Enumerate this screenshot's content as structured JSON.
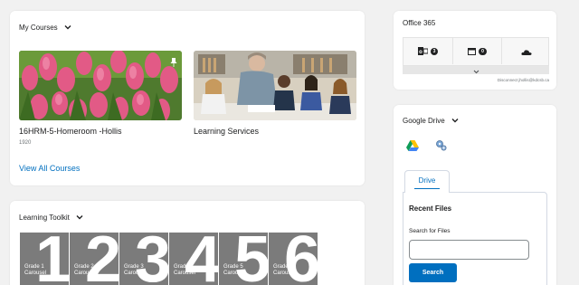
{
  "my_courses": {
    "title": "My Courses",
    "courses": [
      {
        "name": "16HRM-5-Homeroom -Hollis",
        "code": "1920",
        "image": "pink-tulips-photo",
        "pinned": true
      },
      {
        "name": "Learning Services",
        "code": "",
        "image": "classroom-teacher-students-photo",
        "pinned": false
      }
    ],
    "view_all": "View All Courses"
  },
  "learning_toolkit": {
    "title": "Learning Toolkit",
    "tiles": [
      {
        "label": "Grade 1 Carousel",
        "number": "1"
      },
      {
        "label": "Grade 2 Carousel",
        "number": "2"
      },
      {
        "label": "Grade 3 Carousel",
        "number": "3"
      },
      {
        "label": "Grade 4 Carousel",
        "number": "4"
      },
      {
        "label": "Grade 5 Carousel",
        "number": "5"
      },
      {
        "label": "Grade 6 Carousel",
        "number": "6"
      }
    ]
  },
  "office365": {
    "title": "Office 365",
    "mail_count": "3",
    "calendar_count": "0",
    "disconnect_text": "Disconnect jhollis@kdcsb.ca",
    "icons": [
      "outlook-mail-icon",
      "calendar-icon",
      "onedrive-cloud-icon",
      "chevron-down-icon"
    ]
  },
  "google_drive": {
    "title": "Google Drive",
    "tab": "Drive",
    "recent_files": "Recent Files",
    "search_label": "Search for Files",
    "search_placeholder": "",
    "search_button": "Search",
    "icons": [
      "google-drive-icon",
      "settings-gear-icon"
    ]
  },
  "colors": {
    "accent": "#006fbf",
    "page_bg": "#f1f1f1",
    "tile_gray": "#7b7b7b"
  }
}
